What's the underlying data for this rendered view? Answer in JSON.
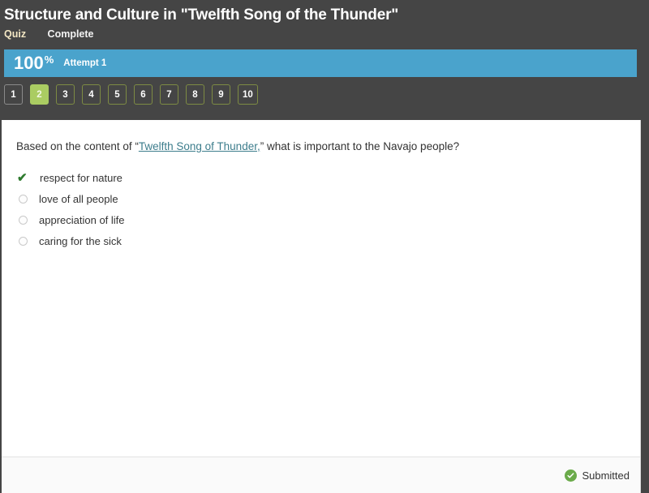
{
  "header": {
    "title": "Structure and Culture in \"Twelfth Song of the Thunder\"",
    "quiz_kind": "Quiz",
    "status": "Complete"
  },
  "score_bar": {
    "value": "100",
    "percent_symbol": "%",
    "attempt_label": "Attempt 1",
    "color": "#4aa3cc"
  },
  "question_nav": {
    "buttons": [
      {
        "label": "1",
        "active": false
      },
      {
        "label": "2",
        "active": true
      },
      {
        "label": "3",
        "active": false
      },
      {
        "label": "4",
        "active": false
      },
      {
        "label": "5",
        "active": false
      },
      {
        "label": "6",
        "active": false
      },
      {
        "label": "7",
        "active": false
      },
      {
        "label": "8",
        "active": false
      },
      {
        "label": "9",
        "active": false
      },
      {
        "label": "10",
        "active": false
      }
    ],
    "active_color": "#aacc62",
    "border_color": "#7d8b43"
  },
  "question": {
    "lead_text": "Based on the content of ",
    "open_quote": "“",
    "link_text": "Twelfth Song of Thunder,",
    "close_quote": "”",
    "trail_text": " what is important to the Navajo people?",
    "link_color": "#3d7d8c",
    "answers": [
      {
        "label": "respect for nature",
        "marker": "check-icon",
        "selected": true
      },
      {
        "label": "love of all people",
        "marker": "radio-icon",
        "selected": false
      },
      {
        "label": "appreciation of life",
        "marker": "radio-icon",
        "selected": false
      },
      {
        "label": "caring for the sick",
        "marker": "radio-icon",
        "selected": false
      }
    ],
    "check_color": "#2e7a2e"
  },
  "footer": {
    "submitted_label": "Submitted",
    "submitted_icon": "check-circle-icon",
    "submitted_icon_color": "#6aaa4a"
  }
}
